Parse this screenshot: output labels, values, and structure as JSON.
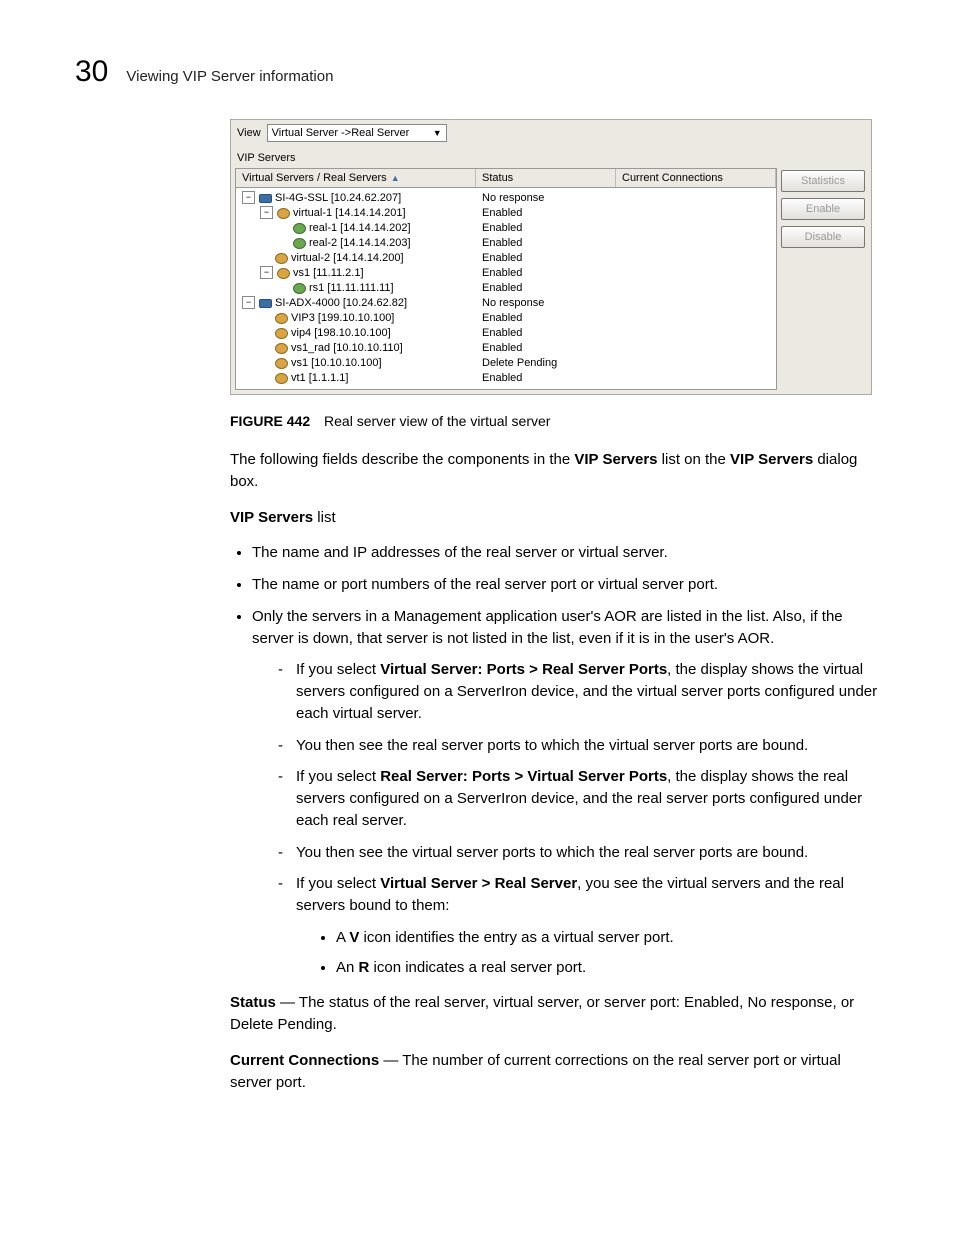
{
  "header": {
    "num": "30",
    "title": "Viewing VIP Server information"
  },
  "panel": {
    "viewLabel": "View",
    "viewValue": "Virtual Server ->Real Server",
    "subTitle": "VIP Servers",
    "cols": {
      "c1": "Virtual Servers / Real Servers",
      "c2": "Status",
      "c3": "Current Connections"
    },
    "rows": [
      {
        "depth": 0,
        "exp": true,
        "icon": "dev",
        "label": "SI-4G-SSL [10.24.62.207]",
        "status": "No response"
      },
      {
        "depth": 1,
        "exp": true,
        "icon": "v",
        "label": "virtual-1 [14.14.14.201]",
        "status": "Enabled"
      },
      {
        "depth": 2,
        "exp": false,
        "icon": "r",
        "label": "real-1 [14.14.14.202]",
        "status": "Enabled"
      },
      {
        "depth": 2,
        "exp": false,
        "icon": "r",
        "label": "real-2 [14.14.14.203]",
        "status": "Enabled"
      },
      {
        "depth": 1,
        "exp": false,
        "icon": "v",
        "label": "virtual-2 [14.14.14.200]",
        "status": "Enabled"
      },
      {
        "depth": 1,
        "exp": true,
        "icon": "v",
        "label": "vs1 [11.11.2.1]",
        "status": "Enabled"
      },
      {
        "depth": 2,
        "exp": false,
        "icon": "r",
        "label": "rs1 [11.11.111.11]",
        "status": "Enabled"
      },
      {
        "depth": 0,
        "exp": true,
        "icon": "dev",
        "label": "SI-ADX-4000 [10.24.62.82]",
        "status": "No response"
      },
      {
        "depth": 1,
        "exp": false,
        "icon": "v",
        "label": "VIP3 [199.10.10.100]",
        "status": "Enabled"
      },
      {
        "depth": 1,
        "exp": false,
        "icon": "v",
        "label": "vip4 [198.10.10.100]",
        "status": "Enabled"
      },
      {
        "depth": 1,
        "exp": false,
        "icon": "v",
        "label": "vs1_rad [10.10.10.110]",
        "status": "Enabled"
      },
      {
        "depth": 1,
        "exp": false,
        "icon": "v",
        "label": "vs1 [10.10.10.100]",
        "status": "Delete Pending"
      },
      {
        "depth": 1,
        "exp": false,
        "icon": "v",
        "label": "vt1 [1.1.1.1]",
        "status": "Enabled"
      }
    ],
    "buttons": {
      "stats": "Statistics",
      "enable": "Enable",
      "disable": "Disable"
    }
  },
  "figcap": {
    "label": "FIGURE 442",
    "text": "Real server view of the virtual server"
  },
  "para": {
    "intro_a": "The following fields describe the components in the ",
    "intro_b": "VIP Servers",
    "intro_c": " list on the ",
    "intro_d": "VIP Servers",
    "intro_e": " dialog box.",
    "list_a": "VIP Servers",
    "list_b": " list",
    "li1": "The name and IP addresses of the real server or virtual server.",
    "li2": "The name or port numbers of the real server port or virtual server port.",
    "li3": "Only the servers in a Management application user's AOR are listed in the list. Also, if the server is down, that server is not listed in the list, even if it is in the user's AOR.",
    "s1a": "If you select ",
    "s1b": "Virtual Server: Ports > Real Server Ports",
    "s1c": ", the display shows the virtual servers configured on a ServerIron device, and the virtual server ports configured under each virtual server.",
    "s2": "You then see the real server ports to which the virtual server ports are bound.",
    "s3a": "If you select ",
    "s3b": "Real Server: Ports > Virtual Server Ports",
    "s3c": ", the display shows the real servers configured on a ServerIron device, and the real server ports configured under each real server.",
    "s4": "You then see the virtual server ports to which the real server ports are bound.",
    "s5a": "If you select ",
    "s5b": "Virtual Server > Real Server",
    "s5c": ", you see the virtual servers and the real servers bound to them:",
    "b1a": "A ",
    "b1b": "V",
    "b1c": " icon identifies the entry as a virtual server port.",
    "b2a": "An ",
    "b2b": "R",
    "b2c": " icon indicates a real server port.",
    "stat_a": "Status",
    "stat_b": " — The status of the real server, virtual server, or server port: Enabled, No response, or Delete Pending.",
    "cc_a": "Current Connections",
    "cc_b": " — The number of current corrections on the real server port or virtual server port."
  }
}
